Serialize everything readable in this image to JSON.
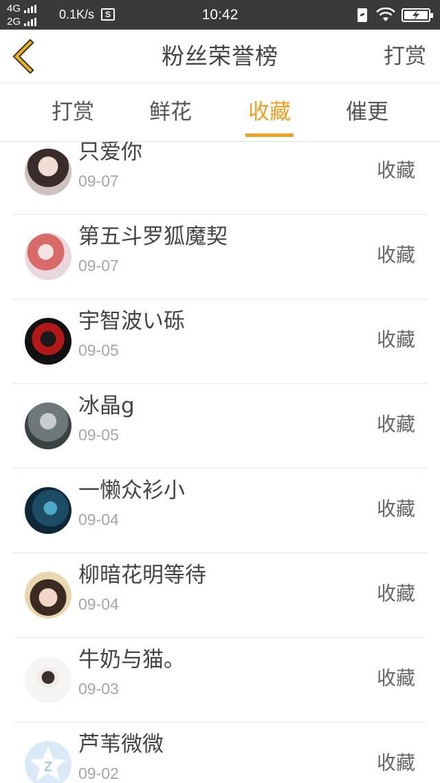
{
  "status_bar": {
    "network_top": "4G",
    "network_bottom": "2G",
    "speed": "0.1K/s",
    "speed_icon_label": "S",
    "time": "10:42",
    "icons": [
      "charging-icon",
      "wifi-icon",
      "battery-icon"
    ]
  },
  "header": {
    "back_icon": "chevron-left-icon",
    "title": "粉丝荣誉榜",
    "action_label": "打赏"
  },
  "tabs": [
    {
      "label": "打赏",
      "active": false
    },
    {
      "label": "鲜花",
      "active": false
    },
    {
      "label": "收藏",
      "active": true
    },
    {
      "label": "催更",
      "active": false
    }
  ],
  "accent_color": "#f0a020",
  "fans": [
    {
      "name": "只爱你",
      "date": "09-07",
      "action": "收藏"
    },
    {
      "name": "第五斗罗狐魔契",
      "date": "09-07",
      "action": "收藏"
    },
    {
      "name": "宇智波い砾",
      "date": "09-05",
      "action": "收藏"
    },
    {
      "name": "冰晶g",
      "date": "09-05",
      "action": "收藏"
    },
    {
      "name": "一懒众衫小",
      "date": "09-04",
      "action": "收藏"
    },
    {
      "name": "柳暗花明等待",
      "date": "09-04",
      "action": "收藏"
    },
    {
      "name": "牛奶与猫。",
      "date": "09-03",
      "action": "收藏"
    },
    {
      "name": "芦苇微微",
      "date": "09-02",
      "action": "收藏"
    }
  ]
}
